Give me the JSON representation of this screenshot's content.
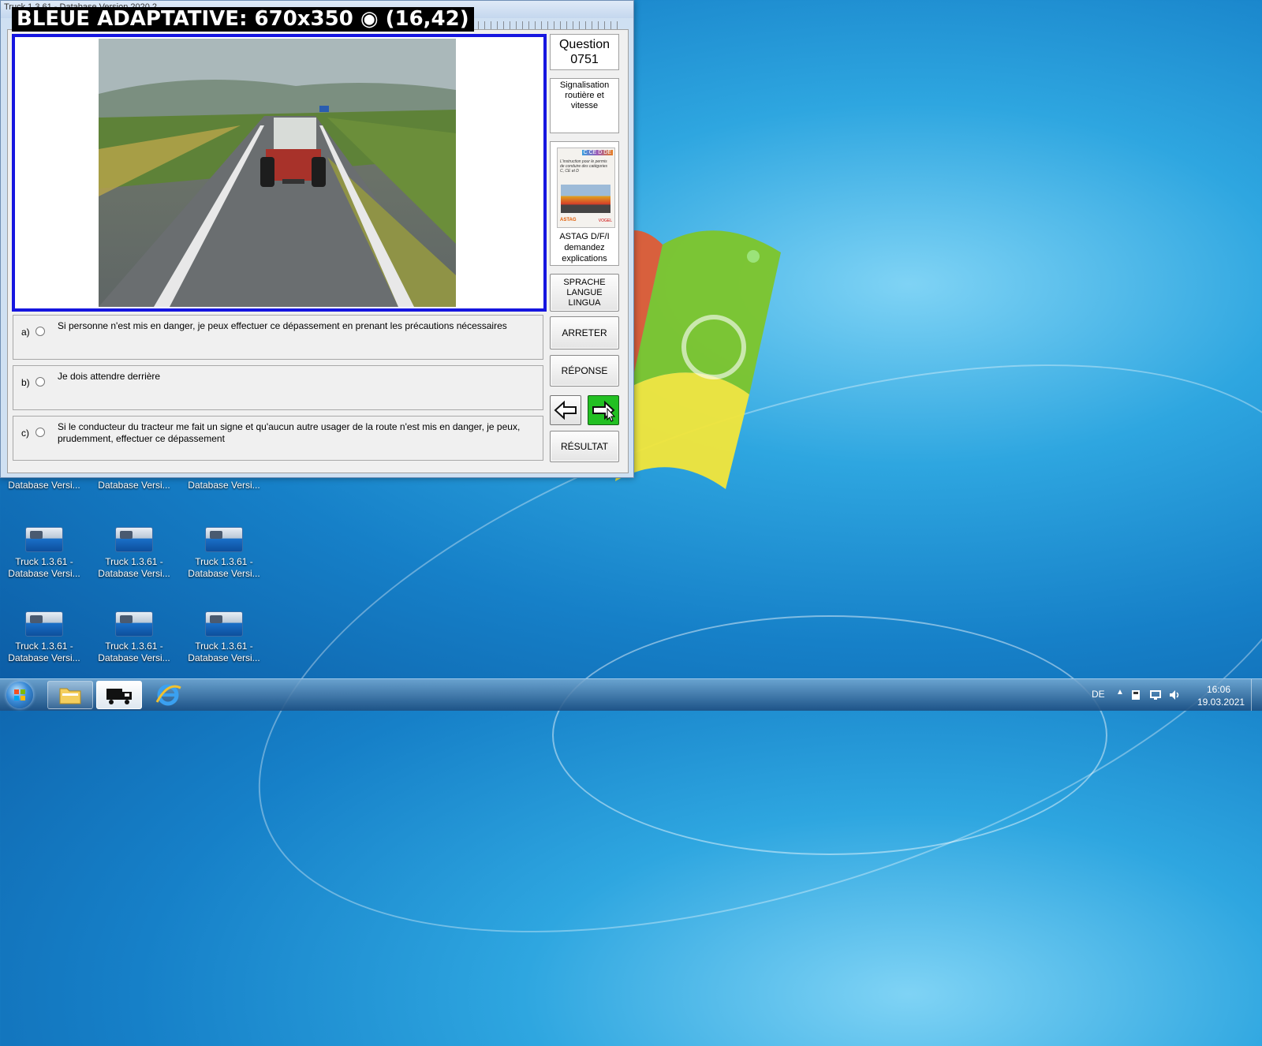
{
  "app": {
    "window_title": "Truck 1.3.61 - Database Version 2020.2",
    "overlay_title": "BLEUE ADAPTATIVE: 670x350 ◉ (16,42)",
    "question_label": "Question",
    "question_number": "0751",
    "category": "Signalisation routière et vitesse",
    "book_caption": "ASTAG D/F/I demandez explications",
    "book_cover": {
      "badges": "C CE D DE",
      "text": "L'instruction pour le permis de conduire des catégories C, CE et D",
      "publisher_left": "ASTAG",
      "publisher_right": "VOGEL"
    },
    "answers": [
      {
        "letter": "a)",
        "text": "Si personne n'est mis en danger, je peux effectuer ce dépassement en prenant les précautions nécessaires"
      },
      {
        "letter": "b)",
        "text": "Je dois attendre derrière"
      },
      {
        "letter": "c)",
        "text": "Si le conducteur du tracteur me fait un signe et qu'aucun autre usager de la route n'est mis en danger, je peux, prudemment, effectuer ce dépassement"
      }
    ],
    "buttons": {
      "language": [
        "SPRACHE",
        "LANGUE",
        "LINGUA"
      ],
      "stop": "ARRETER",
      "answer": "RÉPONSE",
      "result": "RÉSULTAT",
      "prev_icon": "arrow-left-icon",
      "next_icon": "arrow-right-icon"
    }
  },
  "desktop_icons": [
    {
      "line1": "Truck 1.3.61 -",
      "line2": "Database Versi..."
    },
    {
      "line1": "Truck 1.3.61 -",
      "line2": "Database Versi..."
    },
    {
      "line1": "Truck 1.3.61 -",
      "line2": "Database Versi..."
    },
    {
      "line1": "Truck 1.3.61 -",
      "line2": "Database Versi..."
    },
    {
      "line1": "Truck 1.3.61 -",
      "line2": "Database Versi..."
    },
    {
      "line1": "Truck 1.3.61 -",
      "line2": "Database Versi..."
    }
  ],
  "desktop_partial_labels": [
    "Database Versi...",
    "Database Versi...",
    "Database Versi..."
  ],
  "taskbar": {
    "language": "DE",
    "time": "16:06",
    "date": "19.03.2021",
    "pinned": [
      "explorer-icon",
      "truck-app-icon",
      "internet-explorer-icon"
    ]
  },
  "colors": {
    "frame_blue": "#1616e0",
    "next_button_green": "#22c022"
  }
}
